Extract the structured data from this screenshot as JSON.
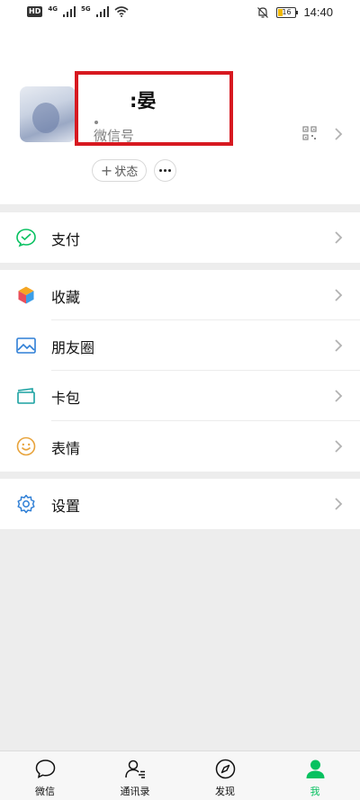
{
  "status_bar": {
    "hd": "HD",
    "net1": "4G",
    "net2": "5G",
    "battery": "16",
    "time": "14:40"
  },
  "profile": {
    "nickname": ":晏",
    "wechat_id_label": "微信号",
    "status_label": "状态",
    "status_plus": "+"
  },
  "menu": {
    "pay": "支付",
    "favorites": "收藏",
    "moments": "朋友圈",
    "cards": "卡包",
    "stickers": "表情",
    "settings": "设置"
  },
  "tabs": [
    {
      "label": "微信"
    },
    {
      "label": "通讯录"
    },
    {
      "label": "发现"
    },
    {
      "label": "我"
    }
  ],
  "colors": {
    "accent": "#07c160",
    "highlight": "#d71920"
  }
}
